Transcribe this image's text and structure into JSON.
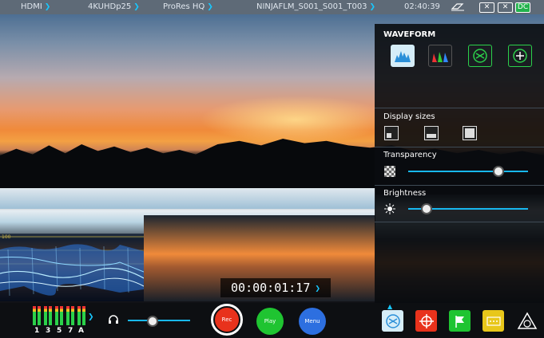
{
  "topbar": {
    "input": "HDMI",
    "resolution": "4KUHDp25",
    "codec": "ProRes HQ",
    "filename": "NINJAFLM_S001_S001_T003",
    "time": "02:40:39",
    "icons": [
      "eraser-icon",
      "x-box-icon",
      "x-box-icon",
      "dc-badge"
    ],
    "dc_label": "DC"
  },
  "panel": {
    "title": "WAVEFORM",
    "waveform_modes": [
      {
        "name": "luma-waveform",
        "active": true
      },
      {
        "name": "rgb-parade",
        "active": false
      },
      {
        "name": "vectorscope-off",
        "active": false
      },
      {
        "name": "add-scope",
        "active": false
      }
    ],
    "display_sizes_label": "Display sizes",
    "transparency_label": "Transparency",
    "transparency_value": 0.75,
    "brightness_label": "Brightness",
    "brightness_value": 0.15
  },
  "waveform_overlay": {
    "top_label": "100"
  },
  "timecode": {
    "value": "00:00:01:17"
  },
  "bottombar": {
    "vu_labels": [
      "1",
      "3",
      "5",
      "7",
      "A"
    ],
    "headphone_volume": 0.4,
    "rec_label": "Rec",
    "play_label": "Play",
    "menu_label": "Menu",
    "colors": {
      "rec": "#e8321c",
      "play": "#1fc431",
      "menu": "#2d6fe0",
      "accent": "#18b8f0"
    },
    "tool_icons": [
      "waveform-tool-icon",
      "focus-peaking-icon",
      "flag-icon",
      "zoom-icon",
      "atomos-logo-icon"
    ]
  }
}
